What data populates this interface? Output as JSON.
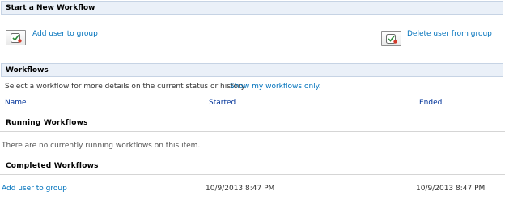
{
  "start_section": {
    "title": "Start a New Workflow",
    "actions": [
      {
        "label": "Add user to group",
        "icon": "workflow-icon"
      },
      {
        "label": "Delete user from group",
        "icon": "workflow-icon"
      }
    ]
  },
  "workflows_section": {
    "title": "Workflows",
    "intro": "Select a workflow for more details on the current status or history.",
    "show_mine_link": "Show my workflows only.",
    "columns": {
      "name": "Name",
      "started": "Started",
      "ended": "Ended"
    },
    "running": {
      "heading": "Running Workflows",
      "empty_message": "There are no currently running workflows on this item."
    },
    "completed": {
      "heading": "Completed Workflows",
      "rows": [
        {
          "name": "Add user to group",
          "started": "10/9/2013 8:47 PM",
          "ended": "10/9/2013 8:47 PM"
        }
      ]
    }
  },
  "colors": {
    "link": "#0072bc",
    "header_bg": "#eaf0f8",
    "header_border": "#c6d3e4"
  }
}
